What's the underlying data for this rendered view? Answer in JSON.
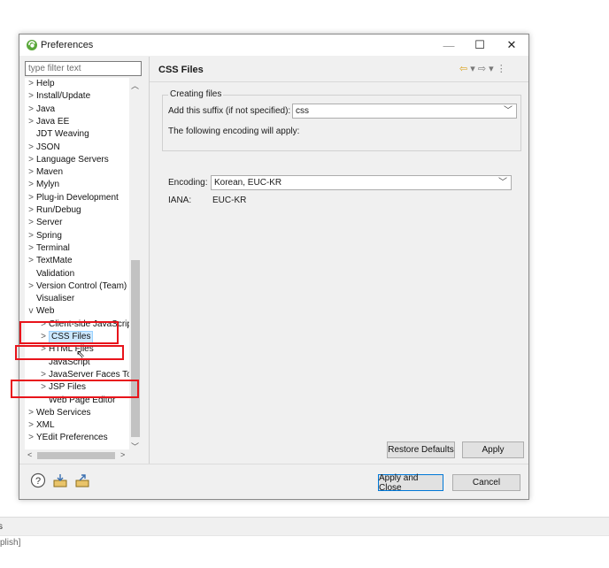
{
  "window": {
    "title": "Preferences"
  },
  "controls": {
    "minimize": "—",
    "maximize": "☐",
    "close": "✕"
  },
  "filter": {
    "placeholder": "type filter text",
    "value": ""
  },
  "tree": {
    "items": [
      {
        "label": "Help",
        "expand": ">"
      },
      {
        "label": "Install/Update",
        "expand": ">"
      },
      {
        "label": "Java",
        "expand": ">"
      },
      {
        "label": "Java EE",
        "expand": ">"
      },
      {
        "label": "JDT Weaving",
        "expand": ""
      },
      {
        "label": "JSON",
        "expand": ">"
      },
      {
        "label": "Language Servers",
        "expand": ">"
      },
      {
        "label": "Maven",
        "expand": ">"
      },
      {
        "label": "Mylyn",
        "expand": ">"
      },
      {
        "label": "Plug-in Development",
        "expand": ">"
      },
      {
        "label": "Run/Debug",
        "expand": ">"
      },
      {
        "label": "Server",
        "expand": ">"
      },
      {
        "label": "Spring",
        "expand": ">"
      },
      {
        "label": "Terminal",
        "expand": ">"
      },
      {
        "label": "TextMate",
        "expand": ">"
      },
      {
        "label": "Validation",
        "expand": ""
      },
      {
        "label": "Version Control (Team)",
        "expand": ">"
      },
      {
        "label": "Visualiser",
        "expand": ""
      },
      {
        "label": "Web",
        "expand": "v"
      },
      {
        "label": "Client-side JavaScript",
        "expand": ">"
      },
      {
        "label": "CSS Files",
        "expand": ">"
      },
      {
        "label": "HTML Files",
        "expand": ">"
      },
      {
        "label": "JavaScript",
        "expand": ""
      },
      {
        "label": "JavaServer Faces Tools",
        "expand": ">"
      },
      {
        "label": "JSP Files",
        "expand": ">"
      },
      {
        "label": "Web Page Editor",
        "expand": ""
      },
      {
        "label": "Web Services",
        "expand": ">"
      },
      {
        "label": "XML",
        "expand": ">"
      },
      {
        "label": "YEdit Preferences",
        "expand": ">"
      }
    ],
    "selected": "CSS Files"
  },
  "page": {
    "title": "CSS Files",
    "group_title": "Creating files",
    "suffix_label": "Add this suffix (if not specified):",
    "suffix_value": "css",
    "encoding_note": "The following encoding will apply:",
    "encoding_label": "Encoding:",
    "encoding_value": "Korean, EUC-KR",
    "iana_label": "IANA:",
    "iana_value": "EUC-KR"
  },
  "nav": {
    "back": "⇦",
    "forward": "⇨",
    "dropdown": "▾",
    "menu": "⋮"
  },
  "buttons": {
    "restore": "Restore Defaults",
    "apply": "Apply",
    "apply_close": "Apply and Close",
    "cancel": "Cancel"
  },
  "icons": {
    "help": "help-icon",
    "import": "import-icon",
    "export": "export-icon"
  },
  "background": {
    "bar_text": "s",
    "line_text": "plish]"
  },
  "colors": {
    "highlight": "#e8141b",
    "selection": "#cce8ff",
    "accent": "#0078d7"
  }
}
